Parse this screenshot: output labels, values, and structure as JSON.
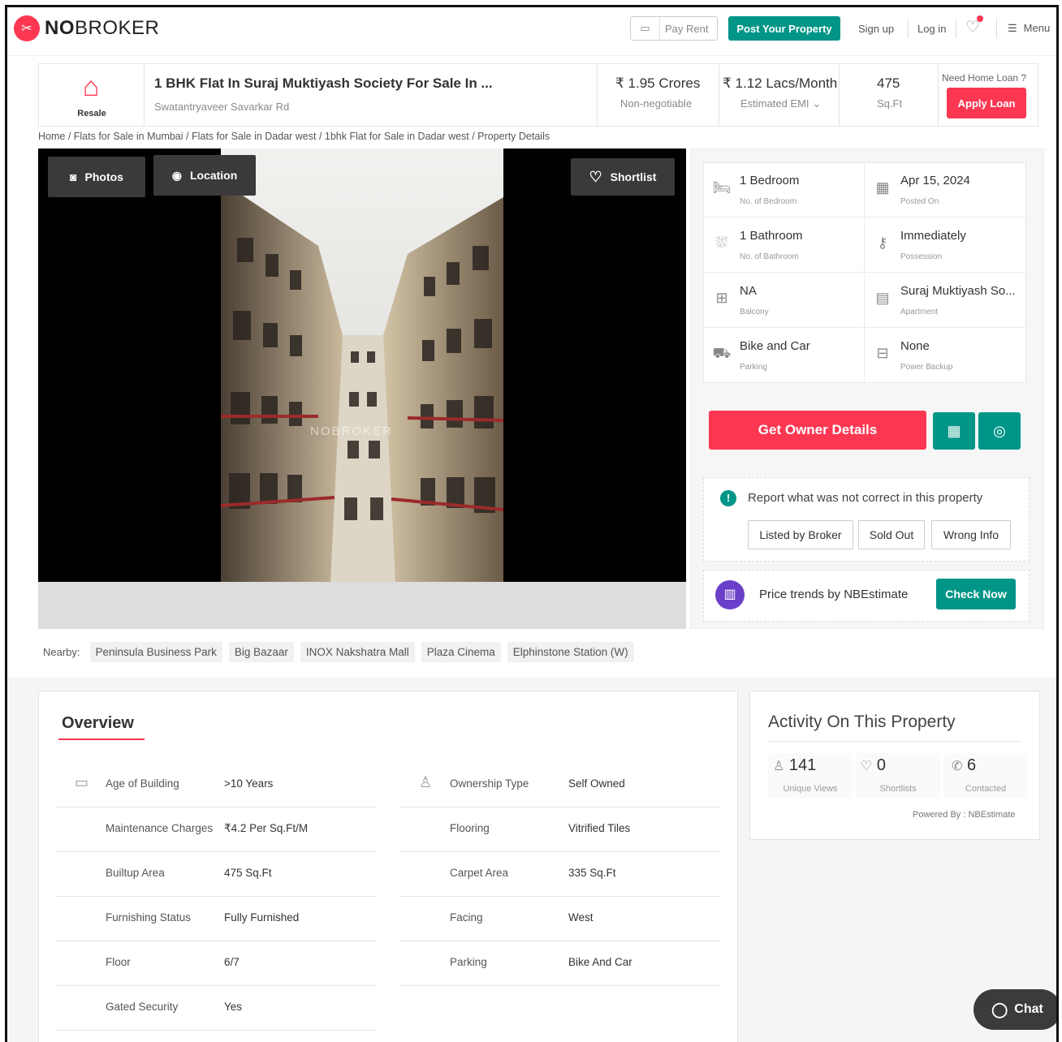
{
  "header": {
    "logo_no": "NO",
    "logo_broker": "BROKER",
    "pay_rent": "Pay Rent",
    "post_property": "Post Your Property",
    "sign_up": "Sign up",
    "log_in": "Log in",
    "menu": "Menu"
  },
  "summary": {
    "property_type": "Resale",
    "title": "1 BHK Flat In Suraj Muktiyash Society For Sale In ...",
    "address": "Swatantryaveer Savarkar Rd",
    "price": "₹ 1.95 Crores",
    "price_note": "Non-negotiable",
    "emi": "₹ 1.12 Lacs/Month",
    "emi_note": "Estimated EMI",
    "area": "475",
    "area_unit": "Sq.Ft",
    "loan_q": "Need Home Loan ?",
    "apply_loan": "Apply Loan"
  },
  "breadcrumb": "Home / Flats for Sale in Mumbai / Flats for Sale in Dadar west / 1bhk Flat for Sale in Dadar west / Property Details",
  "gallery": {
    "photos": "Photos",
    "location": "Location",
    "shortlist": "Shortlist",
    "watermark": "NOBROKER"
  },
  "specs": [
    {
      "value": "1 Bedroom",
      "label": "No. of Bedroom",
      "icon": "bed-icon"
    },
    {
      "value": "Apr 15, 2024",
      "label": "Posted On",
      "icon": "calendar-icon"
    },
    {
      "value": "1 Bathroom",
      "label": "No. of Bathroom",
      "icon": "bath-icon"
    },
    {
      "value": "Immediately",
      "label": "Possession",
      "icon": "key-icon"
    },
    {
      "value": "NA",
      "label": "Balcony",
      "icon": "balcony-icon"
    },
    {
      "value": "Suraj Muktiyash So...",
      "label": "Apartment",
      "icon": "building-icon"
    },
    {
      "value": "Bike and Car",
      "label": "Parking",
      "icon": "car-icon"
    },
    {
      "value": "None",
      "label": "Power Backup",
      "icon": "battery-icon"
    }
  ],
  "actions": {
    "owner_details": "Get Owner Details",
    "report_text": "Report what was not correct in this property",
    "listed_by_broker": "Listed by Broker",
    "sold_out": "Sold Out",
    "wrong_info": "Wrong Info",
    "trends_text": "Price trends by NBEstimate",
    "check_now": "Check Now"
  },
  "nearby": {
    "label": "Nearby:",
    "places": [
      "Peninsula Business Park",
      "Big Bazaar",
      "INOX Nakshatra Mall",
      "Plaza Cinema",
      "Elphinstone Station (W)"
    ]
  },
  "overview": {
    "heading": "Overview",
    "left": [
      {
        "key": "Age of Building",
        "value": ">10 Years"
      },
      {
        "key": "Maintenance Charges",
        "value": "₹4.2 Per Sq.Ft/M"
      },
      {
        "key": "Builtup Area",
        "value": "475 Sq.Ft"
      },
      {
        "key": "Furnishing Status",
        "value": "Fully Furnished"
      },
      {
        "key": "Floor",
        "value": "6/7"
      },
      {
        "key": "Gated Security",
        "value": "Yes"
      }
    ],
    "right": [
      {
        "key": "Ownership Type",
        "value": "Self Owned"
      },
      {
        "key": "Flooring",
        "value": "Vitrified Tiles"
      },
      {
        "key": "Carpet Area",
        "value": "335 Sq.Ft"
      },
      {
        "key": "Facing",
        "value": "West"
      },
      {
        "key": "Parking",
        "value": "Bike And Car"
      }
    ]
  },
  "activity": {
    "heading": "Activity On This Property",
    "views": "141",
    "views_label": "Unique Views",
    "shortlists": "0",
    "shortlists_label": "Shortlists",
    "contacted": "6",
    "contacted_label": "Contacted",
    "powered": "Powered By : NBEstimate"
  },
  "chat": "Chat",
  "colors": {
    "brand": "#fd3752",
    "accent": "#009587",
    "purple": "#6a3fc9"
  }
}
